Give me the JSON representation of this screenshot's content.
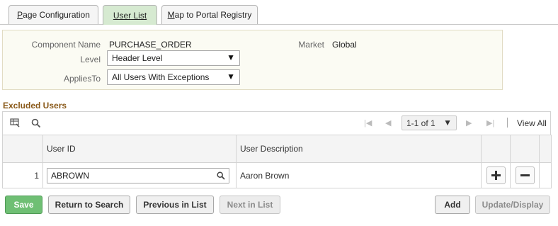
{
  "tabs": {
    "page_configuration": {
      "first": "P",
      "rest": "age Configuration"
    },
    "user_list": "User List",
    "map_registry": {
      "first": "M",
      "rest": "ap to Portal Registry"
    }
  },
  "info": {
    "component_name_label": "Component Name",
    "component_name_value": "PURCHASE_ORDER",
    "market_label": "Market",
    "market_value": "Global",
    "level_label": "Level",
    "level_value": "Header Level",
    "applies_to_label": "AppliesTo",
    "applies_to_value": "All Users With Exceptions"
  },
  "excluded_users": {
    "title": "Excluded Users",
    "pager_text": "1-1 of 1",
    "view_all": "View All",
    "columns": {
      "user_id": "User ID",
      "user_description": "User Description"
    },
    "rows": [
      {
        "num": "1",
        "user_id": "ABROWN",
        "description": "Aaron Brown"
      }
    ]
  },
  "buttons": {
    "save": "Save",
    "return_to_search": "Return to Search",
    "previous_in_list": "Previous in List",
    "next_in_list": "Next in List",
    "add": "Add",
    "update_display": "Update/Display"
  },
  "colors": {
    "active_tab": "#d6ead1",
    "section_title": "#8a5a1a",
    "save_button": "#6fbf74"
  }
}
